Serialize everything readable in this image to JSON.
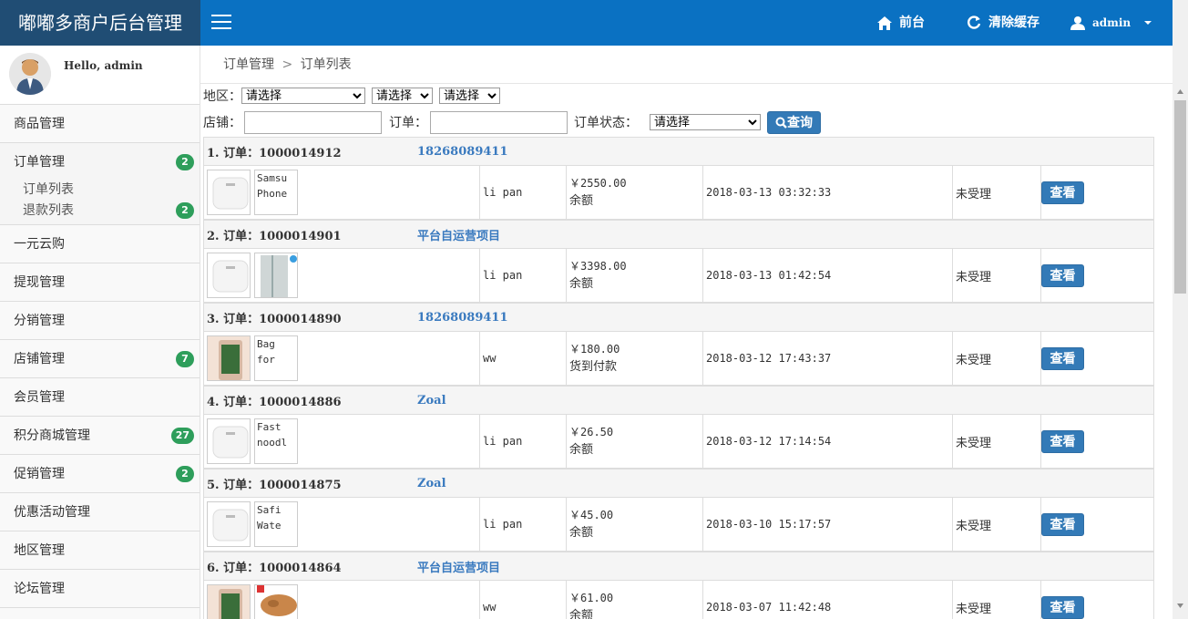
{
  "brand": "嘟嘟多商户后台管理",
  "topnav": {
    "front": "前台",
    "clear_cache": "清除缓存",
    "user": "admin"
  },
  "profile": {
    "greeting": "Hello, admin"
  },
  "sidebar": {
    "items": [
      {
        "label": "商品管理",
        "badge": ""
      },
      {
        "label": "订单管理",
        "badge": "2"
      },
      {
        "label": "一元云购",
        "badge": ""
      },
      {
        "label": "提现管理",
        "badge": ""
      },
      {
        "label": "分销管理",
        "badge": ""
      },
      {
        "label": "店铺管理",
        "badge": "7"
      },
      {
        "label": "会员管理",
        "badge": ""
      },
      {
        "label": "积分商城管理",
        "badge": "27"
      },
      {
        "label": "促销管理",
        "badge": "2"
      },
      {
        "label": "优惠活动管理",
        "badge": ""
      },
      {
        "label": "地区管理",
        "badge": ""
      },
      {
        "label": "论坛管理",
        "badge": ""
      }
    ],
    "subitems": [
      {
        "label": "订单列表",
        "badge": ""
      },
      {
        "label": "退款列表",
        "badge": "2"
      }
    ]
  },
  "breadcrumb": {
    "parent": "订单管理",
    "sep": ">",
    "current": "订单列表"
  },
  "filters": {
    "region_label": "地区：",
    "region_select": "请选择",
    "city_select": "请选择",
    "district_select": "请选择",
    "shop_label": "店铺：",
    "order_label": "订单：",
    "status_label": "订单状态：",
    "status_select": "请选择",
    "query_label": "查询"
  },
  "orders": [
    {
      "title": "1. 订单：1000014912",
      "link": "18268089411",
      "thumb2": "Samsu Phone",
      "buyer": "li pan",
      "price": "￥2550.00",
      "pay": "余额",
      "time": "2018-03-13 03:32:33",
      "status": "未受理",
      "action": "查看"
    },
    {
      "title": "2. 订单：1000014901",
      "link": "平台自运营项目",
      "thumb2": "",
      "buyer": "li pan",
      "price": "￥3398.00",
      "pay": "余额",
      "time": "2018-03-13 01:42:54",
      "status": "未受理",
      "action": "查看"
    },
    {
      "title": "3. 订单：1000014890",
      "link": "18268089411",
      "thumb2": "Bag for",
      "buyer": "ww",
      "price": "￥180.00",
      "pay": "货到付款",
      "time": "2018-03-12 17:43:37",
      "status": "未受理",
      "action": "查看"
    },
    {
      "title": "4. 订单：1000014886",
      "link": "Zoal",
      "thumb2": "Fast noodl",
      "buyer": "li pan",
      "price": "￥26.50",
      "pay": "余额",
      "time": "2018-03-12 17:14:54",
      "status": "未受理",
      "action": "查看"
    },
    {
      "title": "5. 订单：1000014875",
      "link": "Zoal",
      "thumb2": "Safi Wate",
      "buyer": "li pan",
      "price": "￥45.00",
      "pay": "余额",
      "time": "2018-03-10 15:17:57",
      "status": "未受理",
      "action": "查看"
    },
    {
      "title": "6. 订单：1000014864",
      "link": "平台自运营项目",
      "thumb2": "",
      "buyer": "ww",
      "price": "￥61.00",
      "pay": "余额",
      "time": "2018-03-07 11:42:48",
      "status": "未受理",
      "action": "查看"
    }
  ],
  "colors": {
    "topbar": "#0a71c2",
    "brand_bg": "#204d74",
    "badge": "#2e9e5b",
    "button": "#337ab7",
    "link": "#3a7abf"
  }
}
